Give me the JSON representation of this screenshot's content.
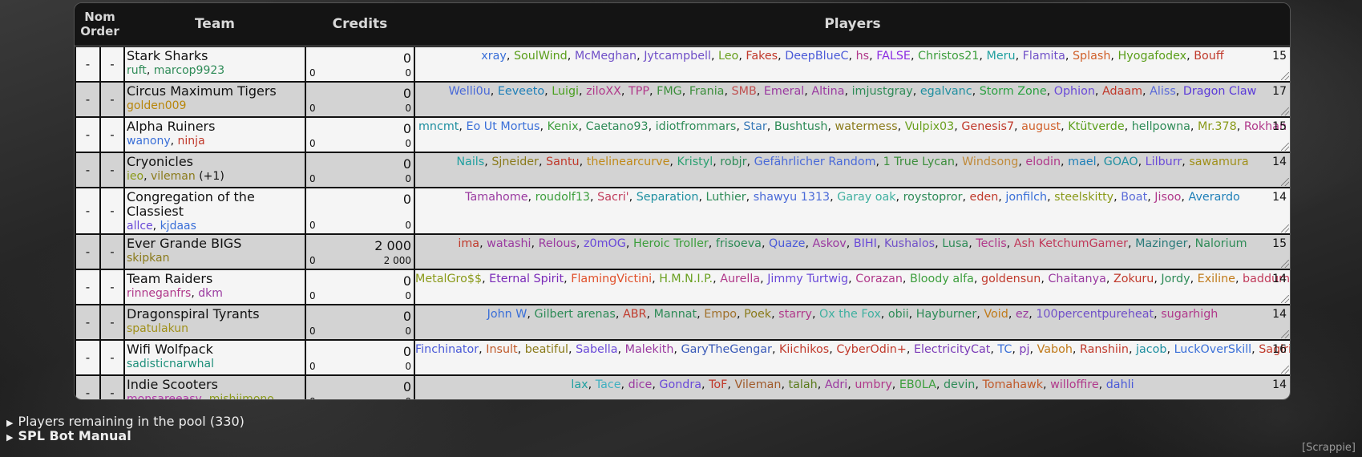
{
  "header": {
    "nom_order_line1": "Nom",
    "nom_order_line2": "Order",
    "team": "Team",
    "credits": "Credits",
    "players": "Players"
  },
  "teams": [
    {
      "name": "Stark Sharks",
      "nom": "-",
      "order": "-",
      "captains": [
        {
          "n": "ruft",
          "c": "#2e8b57"
        },
        {
          "n": "marcop9923",
          "c": "#2e8b57"
        }
      ],
      "extra": "",
      "credits": "0",
      "credits_left": "0",
      "credits_right": "0",
      "count": "15",
      "players": [
        {
          "n": "xray",
          "c": "#3a6fd8"
        },
        {
          "n": "SoulWind",
          "c": "#5a9e1a"
        },
        {
          "n": "McMeghan",
          "c": "#7050c8"
        },
        {
          "n": "Jytcampbell",
          "c": "#7050c8"
        },
        {
          "n": "Leo",
          "c": "#6aa020"
        },
        {
          "n": "Fakes",
          "c": "#c0392b"
        },
        {
          "n": "DeepBlueC",
          "c": "#4a5ad8"
        },
        {
          "n": "hs",
          "c": "#b0388a"
        },
        {
          "n": "FALSE",
          "c": "#8a2be2"
        },
        {
          "n": "Christos21",
          "c": "#3c9e3c"
        },
        {
          "n": "Meru",
          "c": "#20a0a0"
        },
        {
          "n": "Flamita",
          "c": "#7050c8"
        },
        {
          "n": "Splash",
          "c": "#d0602a"
        },
        {
          "n": "Hyogafodex",
          "c": "#5a9e1a"
        },
        {
          "n": "Bouff",
          "c": "#c0392b"
        }
      ]
    },
    {
      "name": "Circus Maximum Tigers",
      "nom": "-",
      "order": "-",
      "captains": [
        {
          "n": "golden009",
          "c": "#b8860b"
        }
      ],
      "extra": "",
      "credits": "0",
      "credits_left": "0",
      "credits_right": "0",
      "count": "17",
      "players": [
        {
          "n": "Welli0u",
          "c": "#4a6ad8"
        },
        {
          "n": "Eeveeto",
          "c": "#1e7fb8"
        },
        {
          "n": "Luigi",
          "c": "#4aa020"
        },
        {
          "n": "ziloXX",
          "c": "#b0388a"
        },
        {
          "n": "TPP",
          "c": "#b0388a"
        },
        {
          "n": "FMG",
          "c": "#3c8e3c"
        },
        {
          "n": "Frania",
          "c": "#3c8e3c"
        },
        {
          "n": "SMB",
          "c": "#c05050"
        },
        {
          "n": "Emeral",
          "c": "#9a3aa0"
        },
        {
          "n": "Altina",
          "c": "#9a3aa0"
        },
        {
          "n": "imjustgray",
          "c": "#2e8b57"
        },
        {
          "n": "egalvanc",
          "c": "#1f8fa0"
        },
        {
          "n": "Storm Zone",
          "c": "#2aa040"
        },
        {
          "n": "Ophion",
          "c": "#6a4ad8"
        },
        {
          "n": "Adaam",
          "c": "#c0392b"
        },
        {
          "n": "Aliss",
          "c": "#5a6ad8"
        },
        {
          "n": "Dragon Claw",
          "c": "#5a3ad8"
        }
      ]
    },
    {
      "name": "Alpha Ruiners",
      "nom": "-",
      "order": "-",
      "captains": [
        {
          "n": "wanony",
          "c": "#3a6fd8"
        },
        {
          "n": "ninja",
          "c": "#c0392b"
        }
      ],
      "extra": "",
      "credits": "0",
      "credits_left": "0",
      "credits_right": "0",
      "count": "15",
      "players": [
        {
          "n": "mncmt",
          "c": "#1f8fa0"
        },
        {
          "n": "Eo Ut Mortus",
          "c": "#3a6fd8"
        },
        {
          "n": "Kenix",
          "c": "#3c9e3c"
        },
        {
          "n": "Caetano93",
          "c": "#2e8b57"
        },
        {
          "n": "idiotfrommars",
          "c": "#2e8b57"
        },
        {
          "n": "Star",
          "c": "#3a7ab8"
        },
        {
          "n": "Bushtush",
          "c": "#2e8b57"
        },
        {
          "n": "watermess",
          "c": "#8a7a1a"
        },
        {
          "n": "Vulpix03",
          "c": "#6aa020"
        },
        {
          "n": "Genesis7",
          "c": "#c0392b"
        },
        {
          "n": "august",
          "c": "#d0602a"
        },
        {
          "n": "Ktütverde",
          "c": "#5a9e1a"
        },
        {
          "n": "hellpowna",
          "c": "#2e8b57"
        },
        {
          "n": "Mr.378",
          "c": "#8a9a1a"
        },
        {
          "n": "Rokhan",
          "c": "#b0388a"
        }
      ]
    },
    {
      "name": "Cryonicles",
      "nom": "-",
      "order": "-",
      "captains": [
        {
          "n": "ieo",
          "c": "#8a9a1a"
        },
        {
          "n": "vileman",
          "c": "#8a7a1a"
        }
      ],
      "extra": " (+1)",
      "credits": "0",
      "credits_left": "0",
      "credits_right": "0",
      "count": "14",
      "players": [
        {
          "n": "Nails",
          "c": "#1f9fa0"
        },
        {
          "n": "Sjneider",
          "c": "#8a7a1a"
        },
        {
          "n": "Santu",
          "c": "#c0392b"
        },
        {
          "n": "thelinearcurve",
          "c": "#c08a1a"
        },
        {
          "n": "Kristyl",
          "c": "#2aa070"
        },
        {
          "n": "robjr",
          "c": "#2e8b57"
        },
        {
          "n": "Gefährlicher Random",
          "c": "#4a6ad8"
        },
        {
          "n": "1 True Lycan",
          "c": "#3c8e3c"
        },
        {
          "n": "Windsong",
          "c": "#c08a3a"
        },
        {
          "n": "elodin",
          "c": "#b0388a"
        },
        {
          "n": "mael",
          "c": "#1e7fb8"
        },
        {
          "n": "GOAO",
          "c": "#1f8fa0"
        },
        {
          "n": "Lilburr",
          "c": "#6a4ad8"
        },
        {
          "n": "sawamura",
          "c": "#a0901a"
        }
      ]
    },
    {
      "name": "Congregation of the Classiest",
      "nom": "-",
      "order": "-",
      "captains": [
        {
          "n": "allce",
          "c": "#6a4ad8"
        },
        {
          "n": "kjdaas",
          "c": "#3a6fd8"
        }
      ],
      "extra": "",
      "credits": "0",
      "credits_left": "0",
      "credits_right": "0",
      "count": "14",
      "players": [
        {
          "n": "Tamahome",
          "c": "#9a3aa0"
        },
        {
          "n": "roudolf13",
          "c": "#3c9e3c"
        },
        {
          "n": "Sacri'",
          "c": "#c03a5a"
        },
        {
          "n": "Separation",
          "c": "#1e8fa0"
        },
        {
          "n": "Luthier",
          "c": "#2e8b57"
        },
        {
          "n": "shawyu 1313",
          "c": "#4a6ad8"
        },
        {
          "n": "Garay oak",
          "c": "#40b0a0"
        },
        {
          "n": "roystopror",
          "c": "#2e8b57"
        },
        {
          "n": "eden",
          "c": "#c0392b"
        },
        {
          "n": "jonfilch",
          "c": "#3a6fd8"
        },
        {
          "n": "steelskitty",
          "c": "#8a9a1a"
        },
        {
          "n": "Boat",
          "c": "#5a6ad8"
        },
        {
          "n": "Jisoo",
          "c": "#b0388a"
        },
        {
          "n": "Averardo",
          "c": "#1e7fb8"
        }
      ]
    },
    {
      "name": "Ever Grande BIGS",
      "nom": "-",
      "order": "-",
      "captains": [
        {
          "n": "skipkan",
          "c": "#8a7a1a"
        }
      ],
      "extra": "",
      "credits": "2 000",
      "credits_left": "0",
      "credits_right": "2 000",
      "count": "15",
      "players": [
        {
          "n": "ima",
          "c": "#c0392b"
        },
        {
          "n": "watashi",
          "c": "#9a3aa0"
        },
        {
          "n": "Relous",
          "c": "#9a3aa0"
        },
        {
          "n": "z0mOG",
          "c": "#6a4ad8"
        },
        {
          "n": "Heroic Troller",
          "c": "#3c9e3c"
        },
        {
          "n": "frisoeva",
          "c": "#2e8b57"
        },
        {
          "n": "Quaze",
          "c": "#4a5ad8"
        },
        {
          "n": "Askov",
          "c": "#9a3aa0"
        },
        {
          "n": "BIHI",
          "c": "#6a4ad8"
        },
        {
          "n": "Kushalos",
          "c": "#7050c8"
        },
        {
          "n": "Lusa",
          "c": "#2e8b57"
        },
        {
          "n": "Teclis",
          "c": "#b0388a"
        },
        {
          "n": "Ash KetchumGamer",
          "c": "#c03a5a"
        },
        {
          "n": "Mazinger",
          "c": "#2a7a7a"
        },
        {
          "n": "Nalorium",
          "c": "#2e8b57"
        }
      ]
    },
    {
      "name": "Team Raiders",
      "nom": "-",
      "order": "-",
      "captains": [
        {
          "n": "rinneganfrs",
          "c": "#b0388a"
        },
        {
          "n": "dkm",
          "c": "#9a3aa0"
        }
      ],
      "extra": "",
      "credits": "0",
      "credits_left": "0",
      "credits_right": "0",
      "count": "14",
      "players": [
        {
          "n": "MetalGro$$",
          "c": "#8a9a1a"
        },
        {
          "n": "Eternal Spirit",
          "c": "#7a2ab8"
        },
        {
          "n": "FlamingVictini",
          "c": "#e0502a"
        },
        {
          "n": "H.M.N.I.P.",
          "c": "#6aa020"
        },
        {
          "n": "Aurella",
          "c": "#b0388a"
        },
        {
          "n": "Jimmy Turtwig",
          "c": "#6a4ad8"
        },
        {
          "n": "Corazan",
          "c": "#b0388a"
        },
        {
          "n": "Bloody alfa",
          "c": "#3c9e3c"
        },
        {
          "n": "goldensun",
          "c": "#c0392b"
        },
        {
          "n": "Chaitanya",
          "c": "#9a3aa0"
        },
        {
          "n": "Zokuru",
          "c": "#c0392b"
        },
        {
          "n": "Jordy",
          "c": "#2e8b57"
        },
        {
          "n": "Exiline",
          "c": "#c07a1a"
        },
        {
          "n": "baddummy",
          "c": "#c03a5a"
        }
      ]
    },
    {
      "name": "Dragonspiral Tyrants",
      "nom": "-",
      "order": "-",
      "captains": [
        {
          "n": "spatulakun",
          "c": "#a0901a"
        }
      ],
      "extra": "",
      "credits": "0",
      "credits_left": "0",
      "credits_right": "0",
      "count": "14",
      "players": [
        {
          "n": "John W",
          "c": "#3a6fd8"
        },
        {
          "n": "Gilbert arenas",
          "c": "#2e8b57"
        },
        {
          "n": "ABR",
          "c": "#c0392b"
        },
        {
          "n": "Mannat",
          "c": "#2e8b57"
        },
        {
          "n": "Empo",
          "c": "#a0702a"
        },
        {
          "n": "Poek",
          "c": "#8a7a1a"
        },
        {
          "n": "starry",
          "c": "#b0388a"
        },
        {
          "n": "Ox the Fox",
          "c": "#40b0a0"
        },
        {
          "n": "obii",
          "c": "#2e8b57"
        },
        {
          "n": "Hayburner",
          "c": "#2e8b57"
        },
        {
          "n": "Void",
          "c": "#c07a1a"
        },
        {
          "n": "ez",
          "c": "#9a3aa0"
        },
        {
          "n": "100percentpureheat",
          "c": "#7050c8"
        },
        {
          "n": "sugarhigh",
          "c": "#b0388a"
        }
      ]
    },
    {
      "name": "Wifi Wolfpack",
      "nom": "-",
      "order": "-",
      "captains": [
        {
          "n": "sadisticnarwhal",
          "c": "#1e8f7a"
        }
      ],
      "extra": "",
      "credits": "0",
      "credits_left": "0",
      "credits_right": "0",
      "count": "16",
      "players": [
        {
          "n": "Finchinator",
          "c": "#4a5ad8"
        },
        {
          "n": "Insult",
          "c": "#c05a2a"
        },
        {
          "n": "beatiful",
          "c": "#8a7a1a"
        },
        {
          "n": "Sabella",
          "c": "#6a4ad8"
        },
        {
          "n": "Malekith",
          "c": "#9a3aa0"
        },
        {
          "n": "GaryTheGengar",
          "c": "#3a5ab8"
        },
        {
          "n": "Kiichikos",
          "c": "#c0392b"
        },
        {
          "n": "CyberOdin+",
          "c": "#c0392b"
        },
        {
          "n": "ElectricityCat",
          "c": "#7a3ab8"
        },
        {
          "n": "TC",
          "c": "#3a6fd8"
        },
        {
          "n": "pj",
          "c": "#7a3ab8"
        },
        {
          "n": "Vaboh",
          "c": "#c07a1a"
        },
        {
          "n": "Ranshiin",
          "c": "#c0392b"
        },
        {
          "n": "jacob",
          "c": "#1e8fa0"
        },
        {
          "n": "LuckOverSkill",
          "c": "#3a6fd8"
        },
        {
          "n": "Sagiri",
          "c": "#c0392b"
        }
      ]
    },
    {
      "name": "Indie Scooters",
      "nom": "-",
      "order": "-",
      "captains": [
        {
          "n": "monsareeasy",
          "c": "#b038a8"
        },
        {
          "n": "mishiimono",
          "c": "#8a9a1a"
        }
      ],
      "extra": "",
      "credits": "0",
      "credits_left": "0",
      "credits_right": "0",
      "count": "14",
      "players": [
        {
          "n": "lax",
          "c": "#20a0a0"
        },
        {
          "n": "Tace",
          "c": "#40b0c0"
        },
        {
          "n": "dice",
          "c": "#9a3aa0"
        },
        {
          "n": "Gondra",
          "c": "#6a4ad8"
        },
        {
          "n": "ToF",
          "c": "#c0392b"
        },
        {
          "n": "Vileman",
          "c": "#a05a2a"
        },
        {
          "n": "talah",
          "c": "#5a7a1a"
        },
        {
          "n": "Adri",
          "c": "#9a3aa0"
        },
        {
          "n": "umbry",
          "c": "#b0388a"
        },
        {
          "n": "EB0LA",
          "c": "#3c9e3c"
        },
        {
          "n": "devin",
          "c": "#2e8b57"
        },
        {
          "n": "Tomahawk",
          "c": "#c05a2a"
        },
        {
          "n": "willoffire",
          "c": "#b0388a"
        },
        {
          "n": "dahli",
          "c": "#4a5ad8"
        }
      ]
    }
  ],
  "footer": {
    "pool": "Players remaining in the pool (330)",
    "manual": "SPL Bot Manual",
    "scrappie": "[Scrappie]"
  }
}
